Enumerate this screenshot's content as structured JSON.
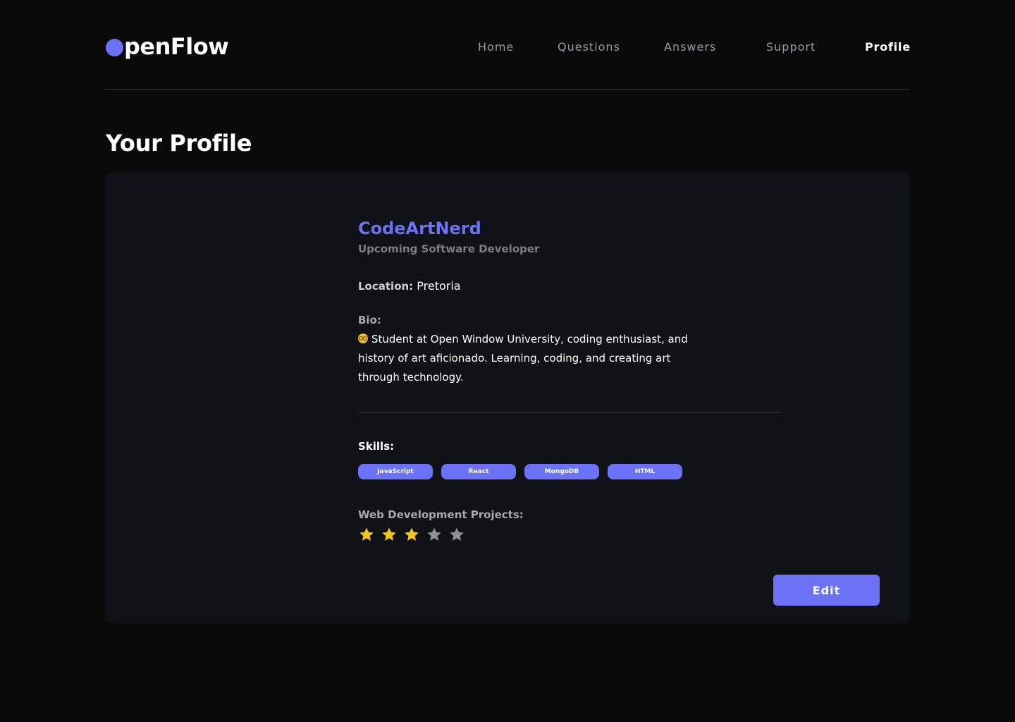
{
  "header": {
    "logo_text": "penFlow",
    "nav": [
      {
        "label": "Home",
        "active": false
      },
      {
        "label": "Questions",
        "active": false
      },
      {
        "label": "Answers",
        "active": false
      },
      {
        "label": "Support",
        "active": false
      },
      {
        "label": "Profile",
        "active": true
      }
    ]
  },
  "page": {
    "title": "Your Profile"
  },
  "profile": {
    "username": "CodeArtNerd",
    "subtitle": "Upcoming Software Developer",
    "location_label": "Location:",
    "location_value": "Pretoria",
    "bio_label": "Bio:",
    "bio_emoji": "nerd-face-icon",
    "bio_text": "Student at Open Window University, coding enthusiast, and history of art aficionado. Learning, coding, and creating art through technology.",
    "skills_label": "Skills:",
    "skills": [
      "JavaScript",
      "React",
      "MongoDB",
      "HTML"
    ],
    "projects_label": "Web Development Projects:",
    "projects_rating": 3,
    "projects_rating_max": 5,
    "edit_label": "Edit"
  },
  "colors": {
    "background": "#0a0a0b",
    "card": "#111218",
    "accent": "#6b72f5",
    "star_filled": "#f5c518",
    "star_empty": "#8e8e93",
    "muted_text": "#9a9a9e"
  }
}
